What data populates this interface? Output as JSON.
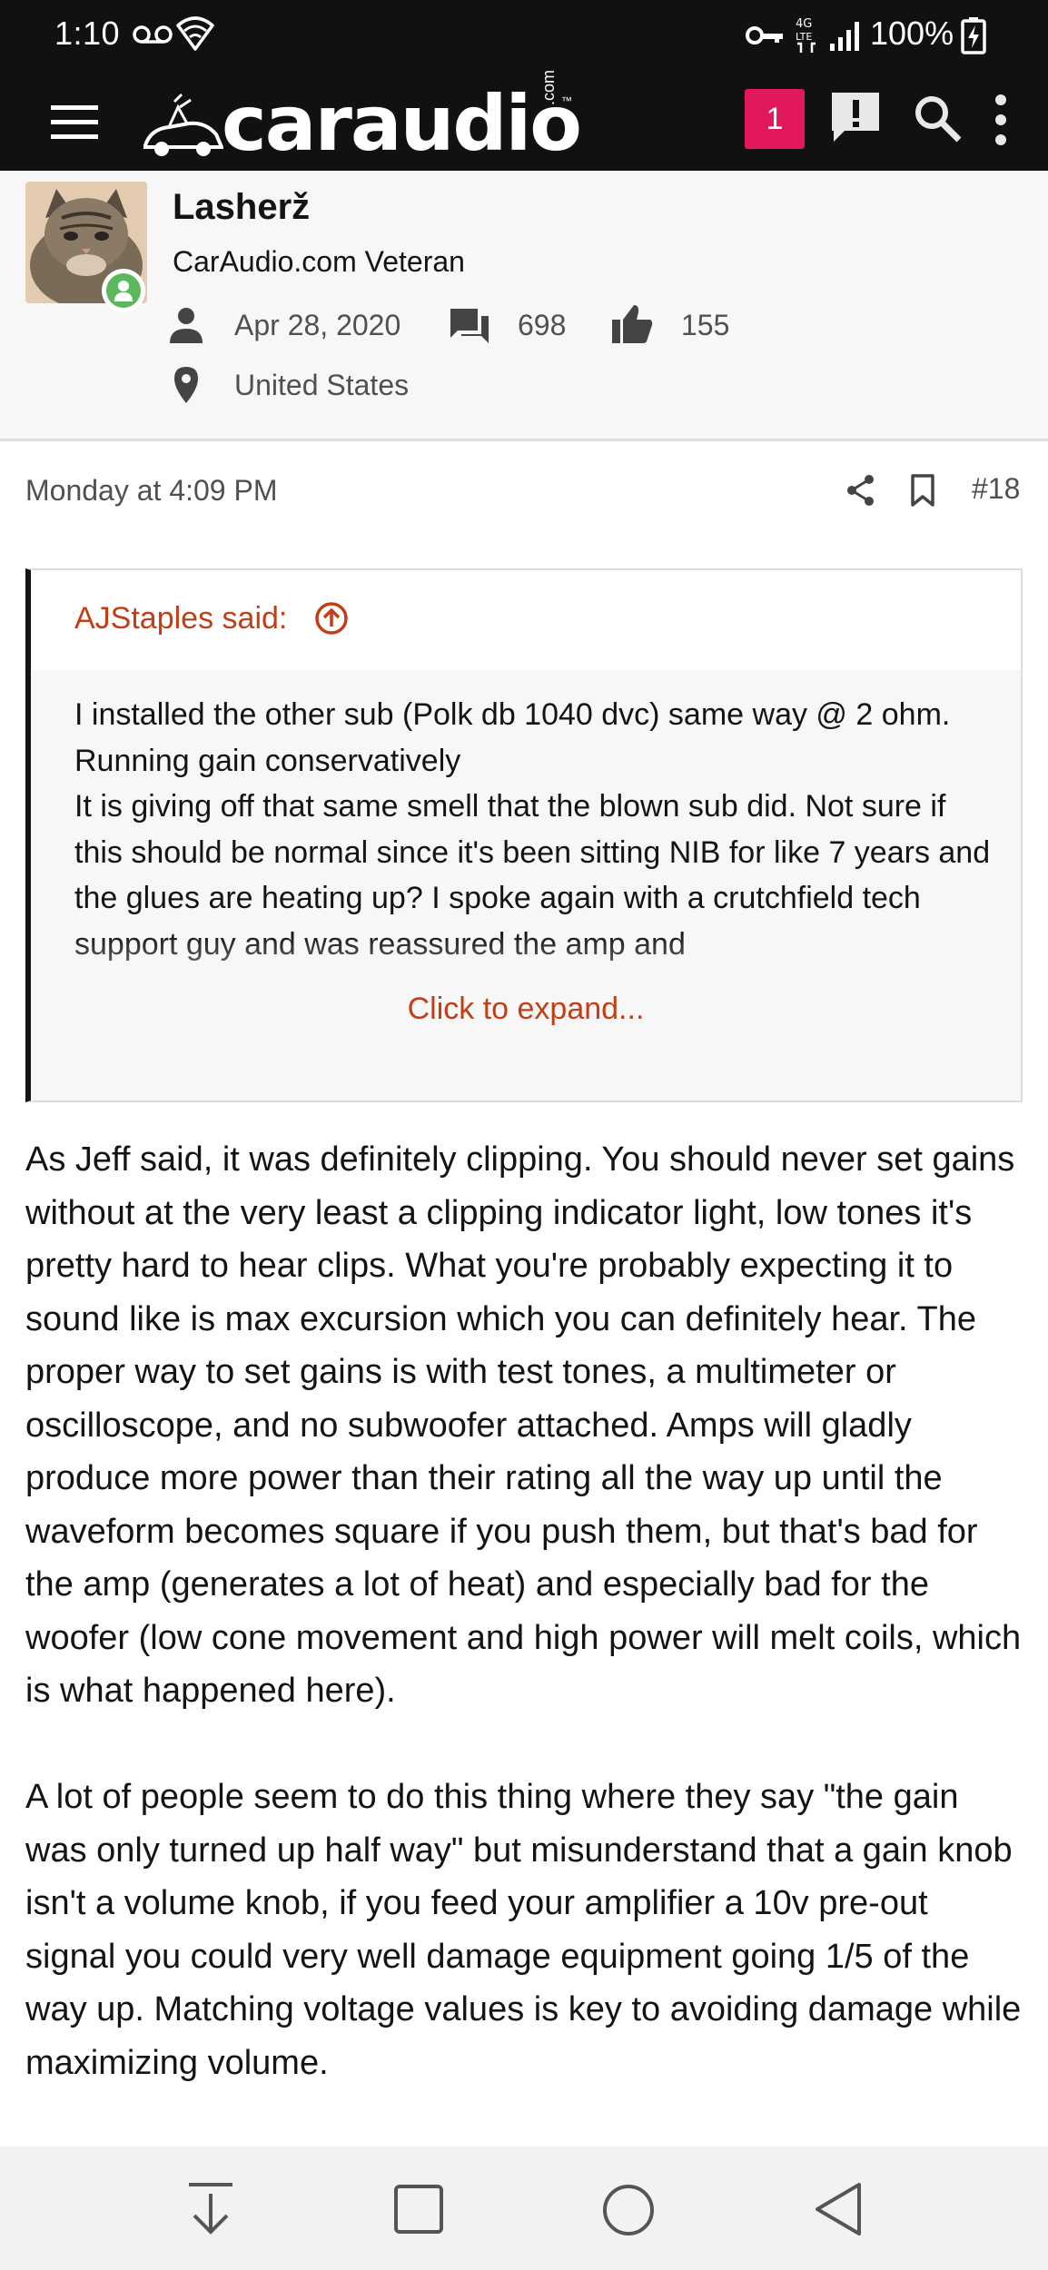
{
  "status_bar": {
    "time": "1:10",
    "battery_text": "100%",
    "icons": [
      "voicemail-icon",
      "wifi-icon",
      "vpn-key-icon",
      "lte-data-icon",
      "signal-icon",
      "battery-charging-icon"
    ]
  },
  "header": {
    "logo_text": "caraudio",
    "logo_suffix": ".com",
    "logo_tm": "™",
    "notification_count": "1",
    "icons": [
      "menu-icon",
      "alert-icon",
      "search-icon",
      "more-vert-icon"
    ]
  },
  "author": {
    "name": "Lasherž",
    "title": "CarAudio.com Veteran",
    "joined": "Apr 28, 2020",
    "messages": "698",
    "reactions": "155",
    "location": "United States"
  },
  "post": {
    "date": "Monday at 4:09 PM",
    "number": "#18",
    "quote": {
      "author": "AJStaples said:",
      "lines": [
        "I installed the other sub (Polk db 1040 dvc) same way @ 2 ohm.",
        "Running gain conservatively",
        "It is giving off that same smell that the blown sub did. Not sure if this should be normal since it's been sitting NIB for like 7 years and the glues are heating up? I spoke again with a crutchfield tech support guy and was reassured the amp and"
      ],
      "expand_label": "Click to expand..."
    },
    "paragraphs": [
      "As Jeff said, it was definitely clipping. You should never set gains without at the very least a clipping indicator light, low tones it's pretty hard to hear clips. What you're probably expecting it to sound like is max excursion which you can definitely hear. The proper way to set gains is with test tones, a multimeter or oscilloscope, and no subwoofer attached. Amps will gladly produce more power than their rating all the way up until the waveform becomes square if you push them, but that's bad for the amp (generates a lot of heat) and especially bad for the woofer (low cone movement and high power will melt coils, which is what happened here).",
      "A lot of people seem to do this thing where they say \"the gain was only turned up half way\" but misunderstand that a gain knob isn't a volume knob, if you feed your amplifier a 10v pre-out signal you could very well damage equipment going 1/5 of the way up. Matching voltage values is key to avoiding damage while maximizing volume."
    ]
  },
  "nav_bar": {
    "icons": [
      "scroll-down-icon",
      "recents-icon",
      "home-icon",
      "back-icon"
    ]
  },
  "colors": {
    "header_bg": "#111111",
    "accent_red": "#c33e15",
    "notification_pink": "#e1195c",
    "online_green": "#5cb85c",
    "meta_gray": "#505050"
  }
}
